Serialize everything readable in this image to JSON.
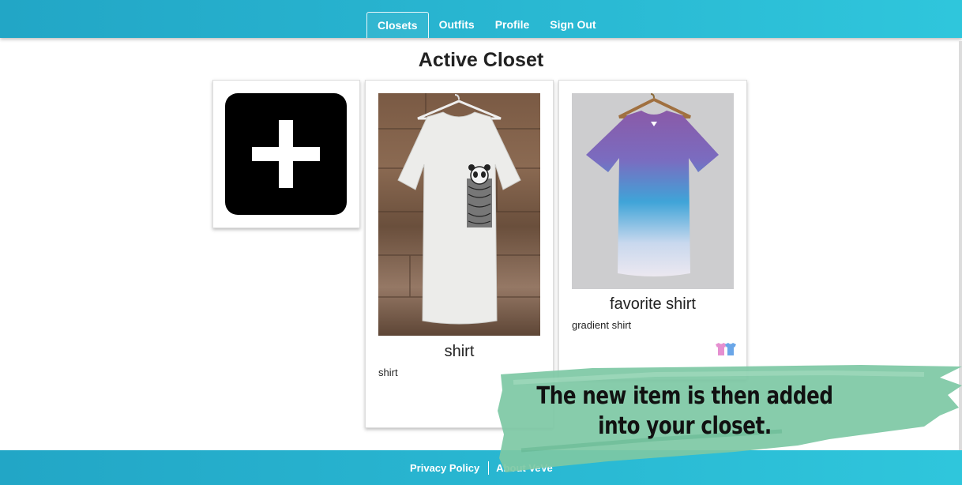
{
  "nav": {
    "items": [
      {
        "label": "Closets",
        "active": true
      },
      {
        "label": "Outfits",
        "active": false
      },
      {
        "label": "Profile",
        "active": false
      },
      {
        "label": "Sign Out",
        "active": false
      }
    ]
  },
  "page": {
    "title": "Active Closet"
  },
  "closet": {
    "add_button_icon": "plus-icon",
    "items": [
      {
        "name": "shirt",
        "description": "shirt",
        "photo": "white t-shirt with panda pocket on hanger"
      },
      {
        "name": "favorite shirt",
        "description": "gradient shirt",
        "photo": "purple-to-blue gradient t-shirt on hanger",
        "badge_icon": "shirts-icon"
      }
    ]
  },
  "footer": {
    "links": [
      "Privacy Policy",
      "About VeVe"
    ]
  },
  "annotation": {
    "text": "The new item is then added into your closet."
  },
  "colors": {
    "header_start": "#22a6c6",
    "header_end": "#2fc6dc",
    "annotation_green": "#7dc8a4"
  }
}
